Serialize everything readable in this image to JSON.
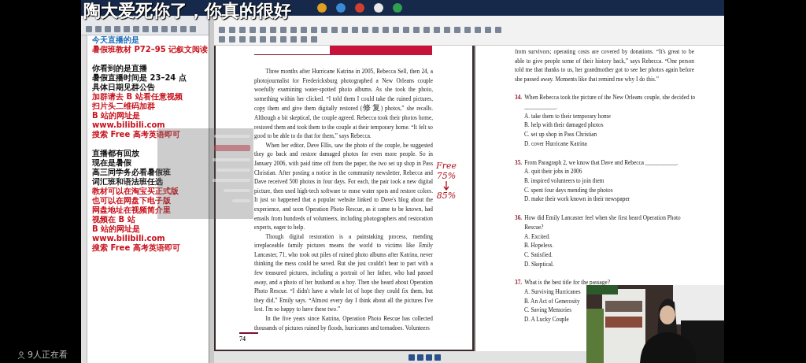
{
  "danmaku": "陶大爱死你了，你真的很好",
  "viewer_count": "9人正在看",
  "notes": {
    "lines": [
      {
        "kind": "text",
        "text": "今天直播的是",
        "color": "#1d6fb8"
      },
      {
        "kind": "text",
        "text": "暑假班教材 P72–95 记叙文阅读",
        "color": "#c8121c"
      },
      {
        "kind": "blank"
      },
      {
        "kind": "text",
        "text": "你看到的是直播",
        "color": "#111111"
      },
      {
        "kind": "text",
        "text": "暑假直播时间是 23–24 点",
        "color": "#111111"
      },
      {
        "kind": "text",
        "text": "具体日期见群公告",
        "color": "#111111"
      },
      {
        "kind": "text",
        "text": "加群请去 B 站看任意视频",
        "color": "#c8121c"
      },
      {
        "kind": "text",
        "text": "扫片头二维码加群",
        "color": "#c8121c"
      },
      {
        "kind": "text",
        "text": "B 站的网址是",
        "color": "#c8121c"
      },
      {
        "kind": "text",
        "text": "www.bilibili.com",
        "color": "#c8121c"
      },
      {
        "kind": "text",
        "text": "搜索 Free 高考英语即可",
        "color": "#c8121c"
      },
      {
        "kind": "blank"
      },
      {
        "kind": "text",
        "text": "直播都有回放",
        "color": "#111111"
      },
      {
        "kind": "text",
        "text": "现在是暑假",
        "color": "#111111"
      },
      {
        "kind": "text",
        "text": "高三同学务必看暑假班",
        "color": "#111111"
      },
      {
        "kind": "text",
        "text": "词汇班和语法班任选",
        "color": "#111111"
      },
      {
        "kind": "text",
        "text": "教材可以在淘宝买正式版",
        "color": "#c8121c"
      },
      {
        "kind": "text",
        "text": "也可以在网盘下电子版",
        "color": "#c8121c"
      },
      {
        "kind": "text",
        "text": "网盘地址在视频简介里",
        "color": "#c8121c"
      },
      {
        "kind": "text",
        "text": "视频在 B 站",
        "color": "#c8121c"
      },
      {
        "kind": "text",
        "text": "B 站的网址是",
        "color": "#c8121c"
      },
      {
        "kind": "text",
        "text": "www.bilibili.com",
        "color": "#c8121c"
      },
      {
        "kind": "text",
        "text": "搜索 Free 高考英语即可",
        "color": "#c8121c"
      }
    ]
  },
  "left_page": {
    "paragraphs": [
      "Three months after Hurricane Katrina in 2005, Rebecca Sell, then 24, a photojournalist for Fredericksburg photographed a New Orleans couple woefully examining water-spotted photo albums. As she took the photo, something within her clicked. “I told them I could take the ruined pictures, copy them and give them digitally restored (修复) photos,” she recalls. Although a bit skeptical, the couple agreed. Rebecca took their photos home, restored them and took them to the couple at their temporary home. “It felt so good to be able to do that for them,” says Rebecca.",
      "When her editor, Dave Ellis, saw the photo of the couple, he suggested they go back and restore damaged photos for even more people. So in January 2006, with paid time off from the paper, the two set up shop in Pass Christian. After posting a notice in the community newsletter, Rebecca and Dave received 500 photos in four days. For each, the pair took a new digital picture, then used high-tech software to erase water spots and restore colors. It just so happened that a popular website linked to Dave's blog about the experience, and soon Operation Photo Rescue, as it came to be known, had emails from hundreds of volunteers, including photographers and restoration experts, eager to help.",
      "Though digital restoration is a painstaking process, mending irreplaceable family pictures means the world to victims like Emily Lancaster, 71, who took out piles of ruined photo albums after Katrina, never thinking the mess could be saved. But she just couldn't bear to part with a few treasured pictures, including a portrait of her father, who had passed away, and a photo of her husband as a boy. Then she heard about Operation Photo Rescue. “I didn't have a whole lot of hope they could fix them, but they did,” Emily says. “Almost every day I think about all the pictures I've lost. I'm so happy to have these two.”",
      "In the five years since Katrina, Operation Photo Rescue has collected thousands of pictures ruined by floods, hurricanes and tornadoes. Volunteers"
    ],
    "page_number": "74",
    "annotations": [
      "Free",
      "75%",
      "85%"
    ]
  },
  "right_page": {
    "paragraphs": [
      "from survivors; operating costs are covered by donations. “It's great to be able to give people some of their history back,” says Rebecca. “One person told me that thanks to us, her grandmother got to see her photos again before she passed away. Moments like that remind me why I do this.”"
    ],
    "questions": [
      {
        "number": "34.",
        "text": "When Rebecca took the picture of the New Orleans couple, she decided to ___________.",
        "options": [
          "A. take them to their temporary home",
          "B. help with their damaged photos",
          "C. set up shop in Pass Christian",
          "D. cover Hurricane Katrina"
        ]
      },
      {
        "number": "35.",
        "text": "From Paragraph 2, we know that Dave and Rebecca ___________.",
        "options": [
          "A. quit their jobs in 2006",
          "B. inspired volunteers to join them",
          "C. spent four days mending the photos",
          "D. make their work known in their newspaper"
        ]
      },
      {
        "number": "36.",
        "text": "How did Emily Lancaster feel when she first heard Operation Photo Rescue?",
        "options": [
          "A. Excited.",
          "B. Hopeless.",
          "C. Satisfied.",
          "D. Skeptical."
        ]
      },
      {
        "number": "37.",
        "text": "What is the best title for the passage?",
        "options": [
          "A. Surviving Hurricanes",
          "B. An Act of Generosity",
          "C. Saving Memories",
          "D. A Lucky Couple"
        ]
      }
    ]
  }
}
